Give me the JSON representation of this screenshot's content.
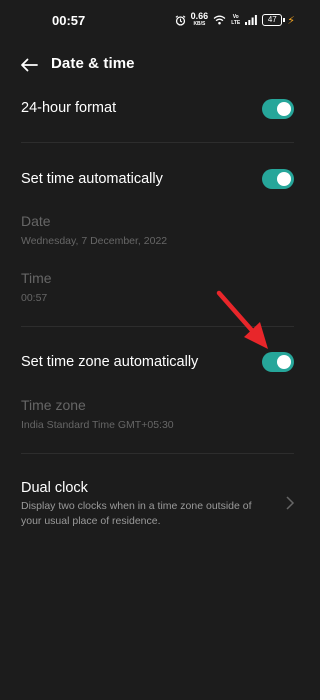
{
  "status_bar": {
    "time": "00:57",
    "net_speed_value": "0.66",
    "net_speed_unit": "KB/S",
    "volte_top": "Vo",
    "volte_bottom": "LTE",
    "battery_level": "47"
  },
  "header": {
    "title": "Date & time"
  },
  "settings": {
    "hour_format": {
      "label": "24-hour format",
      "enabled": true
    },
    "set_time_auto": {
      "label": "Set time automatically",
      "enabled": true
    },
    "date": {
      "label": "Date",
      "value": "Wednesday, 7 December, 2022"
    },
    "time": {
      "label": "Time",
      "value": "00:57"
    },
    "set_tz_auto": {
      "label": "Set time zone automatically",
      "enabled": true
    },
    "time_zone": {
      "label": "Time zone",
      "value": "India Standard Time GMT+05:30"
    },
    "dual_clock": {
      "label": "Dual clock",
      "description": "Display two clocks when in a time zone outside of your usual place of residence."
    }
  },
  "colors": {
    "background": "#1c1c1c",
    "toggle_on": "#26a69a",
    "disabled_text": "#666666",
    "annotation_arrow": "#e8262a"
  }
}
